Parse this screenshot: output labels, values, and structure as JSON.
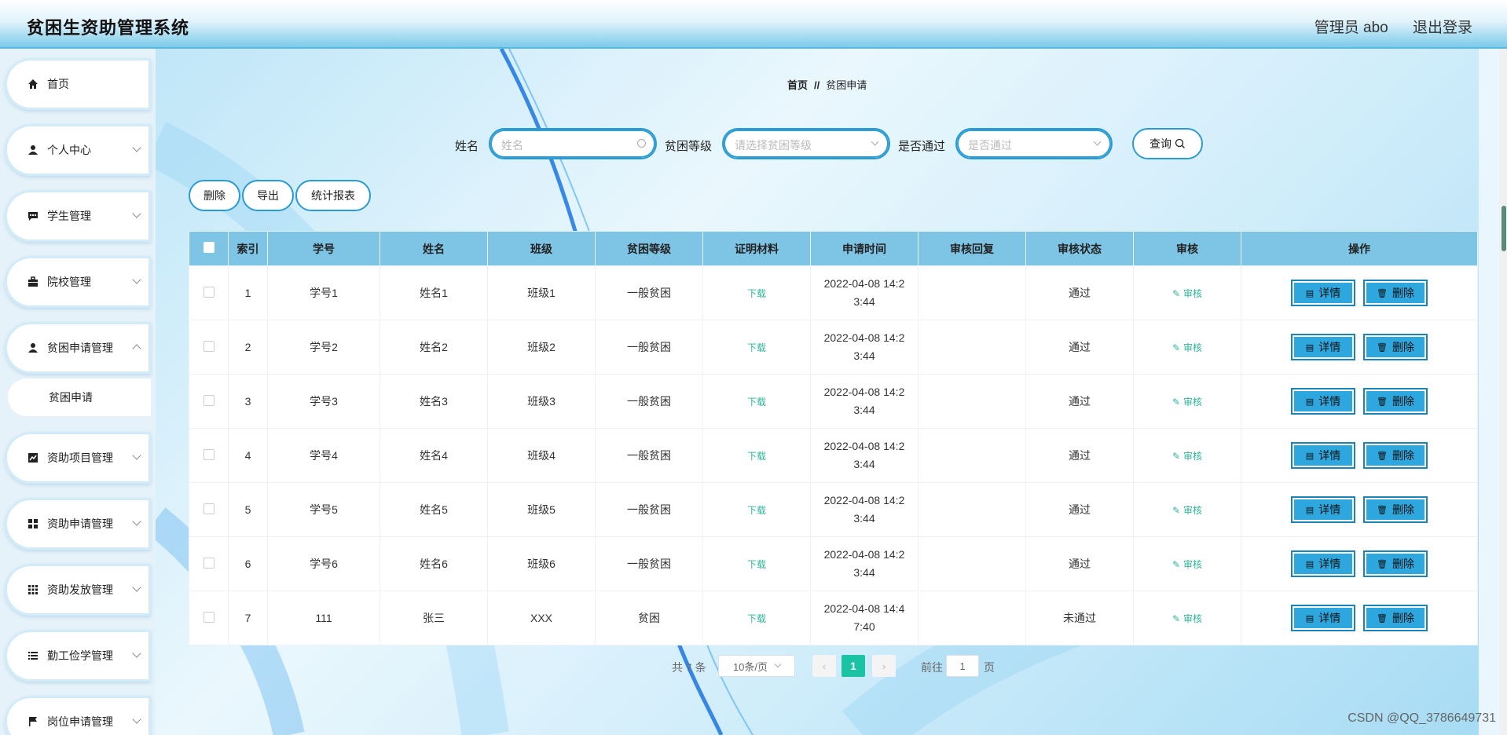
{
  "app": {
    "title": "贫困生资助管理系统"
  },
  "header": {
    "user": "管理员 abo",
    "logout": "退出登录"
  },
  "sidebar": {
    "items": [
      {
        "label": "首页",
        "icon": "home-icon"
      },
      {
        "label": "个人中心",
        "icon": "user-icon"
      },
      {
        "label": "学生管理",
        "icon": "chat-icon"
      },
      {
        "label": "院校管理",
        "icon": "briefcase-icon"
      },
      {
        "label": "贫困申请管理",
        "icon": "user-icon"
      },
      {
        "label": "资助项目管理",
        "icon": "chart-icon"
      },
      {
        "label": "资助申请管理",
        "icon": "grid-icon"
      },
      {
        "label": "资助发放管理",
        "icon": "apps-icon"
      },
      {
        "label": "勤工俭学管理",
        "icon": "list-icon"
      },
      {
        "label": "岗位申请管理",
        "icon": "flag-icon"
      }
    ],
    "submenu": {
      "label": "贫困申请"
    }
  },
  "breadcrumb": {
    "home": "首页",
    "sep": "//",
    "current": "贫困申请"
  },
  "search": {
    "name_label": "姓名",
    "name_placeholder": "姓名",
    "level_label": "贫困等级",
    "level_placeholder": "请选择贫困等级",
    "pass_label": "是否通过",
    "pass_placeholder": "是否通过",
    "query_button": "查询"
  },
  "toolbar": {
    "delete": "删除",
    "export": "导出",
    "report": "统计报表"
  },
  "table": {
    "columns": [
      "索引",
      "学号",
      "姓名",
      "班级",
      "贫困等级",
      "证明材料",
      "申请时间",
      "审核回复",
      "审核状态",
      "审核",
      "操作"
    ],
    "rows": [
      {
        "index": "1",
        "sid": "学号1",
        "name": "姓名1",
        "cls": "班级1",
        "level": "一般贫困",
        "material": "下载",
        "time1": "2022-04-08 14:2",
        "time2": "3:44",
        "reply": "",
        "status": "通过",
        "audit": "审核"
      },
      {
        "index": "2",
        "sid": "学号2",
        "name": "姓名2",
        "cls": "班级2",
        "level": "一般贫困",
        "material": "下载",
        "time1": "2022-04-08 14:2",
        "time2": "3:44",
        "reply": "",
        "status": "通过",
        "audit": "审核"
      },
      {
        "index": "3",
        "sid": "学号3",
        "name": "姓名3",
        "cls": "班级3",
        "level": "一般贫困",
        "material": "下载",
        "time1": "2022-04-08 14:2",
        "time2": "3:44",
        "reply": "",
        "status": "通过",
        "audit": "审核"
      },
      {
        "index": "4",
        "sid": "学号4",
        "name": "姓名4",
        "cls": "班级4",
        "level": "一般贫困",
        "material": "下载",
        "time1": "2022-04-08 14:2",
        "time2": "3:44",
        "reply": "",
        "status": "通过",
        "audit": "审核"
      },
      {
        "index": "5",
        "sid": "学号5",
        "name": "姓名5",
        "cls": "班级5",
        "level": "一般贫困",
        "material": "下载",
        "time1": "2022-04-08 14:2",
        "time2": "3:44",
        "reply": "",
        "status": "通过",
        "audit": "审核"
      },
      {
        "index": "6",
        "sid": "学号6",
        "name": "姓名6",
        "cls": "班级6",
        "level": "一般贫困",
        "material": "下载",
        "time1": "2022-04-08 14:2",
        "time2": "3:44",
        "reply": "",
        "status": "通过",
        "audit": "审核"
      },
      {
        "index": "7",
        "sid": "111",
        "name": "张三",
        "cls": "XXX",
        "level": "贫困",
        "material": "下载",
        "time1": "2022-04-08 14:4",
        "time2": "7:40",
        "reply": "",
        "status": "未通过",
        "audit": "审核"
      }
    ],
    "detail_button": "详情",
    "delete_button": "删除"
  },
  "pagination": {
    "total": "共 7 条",
    "page_size": "10条/页",
    "current": "1",
    "goto_prefix": "前往",
    "goto_value": "1",
    "goto_suffix": "页"
  },
  "watermark": "CSDN @QQ_3786649731",
  "colors": {
    "accent": "#2ea6de",
    "header_th": "#7ec4e4",
    "success": "#19c3a4",
    "link_green": "#2fb39a"
  }
}
